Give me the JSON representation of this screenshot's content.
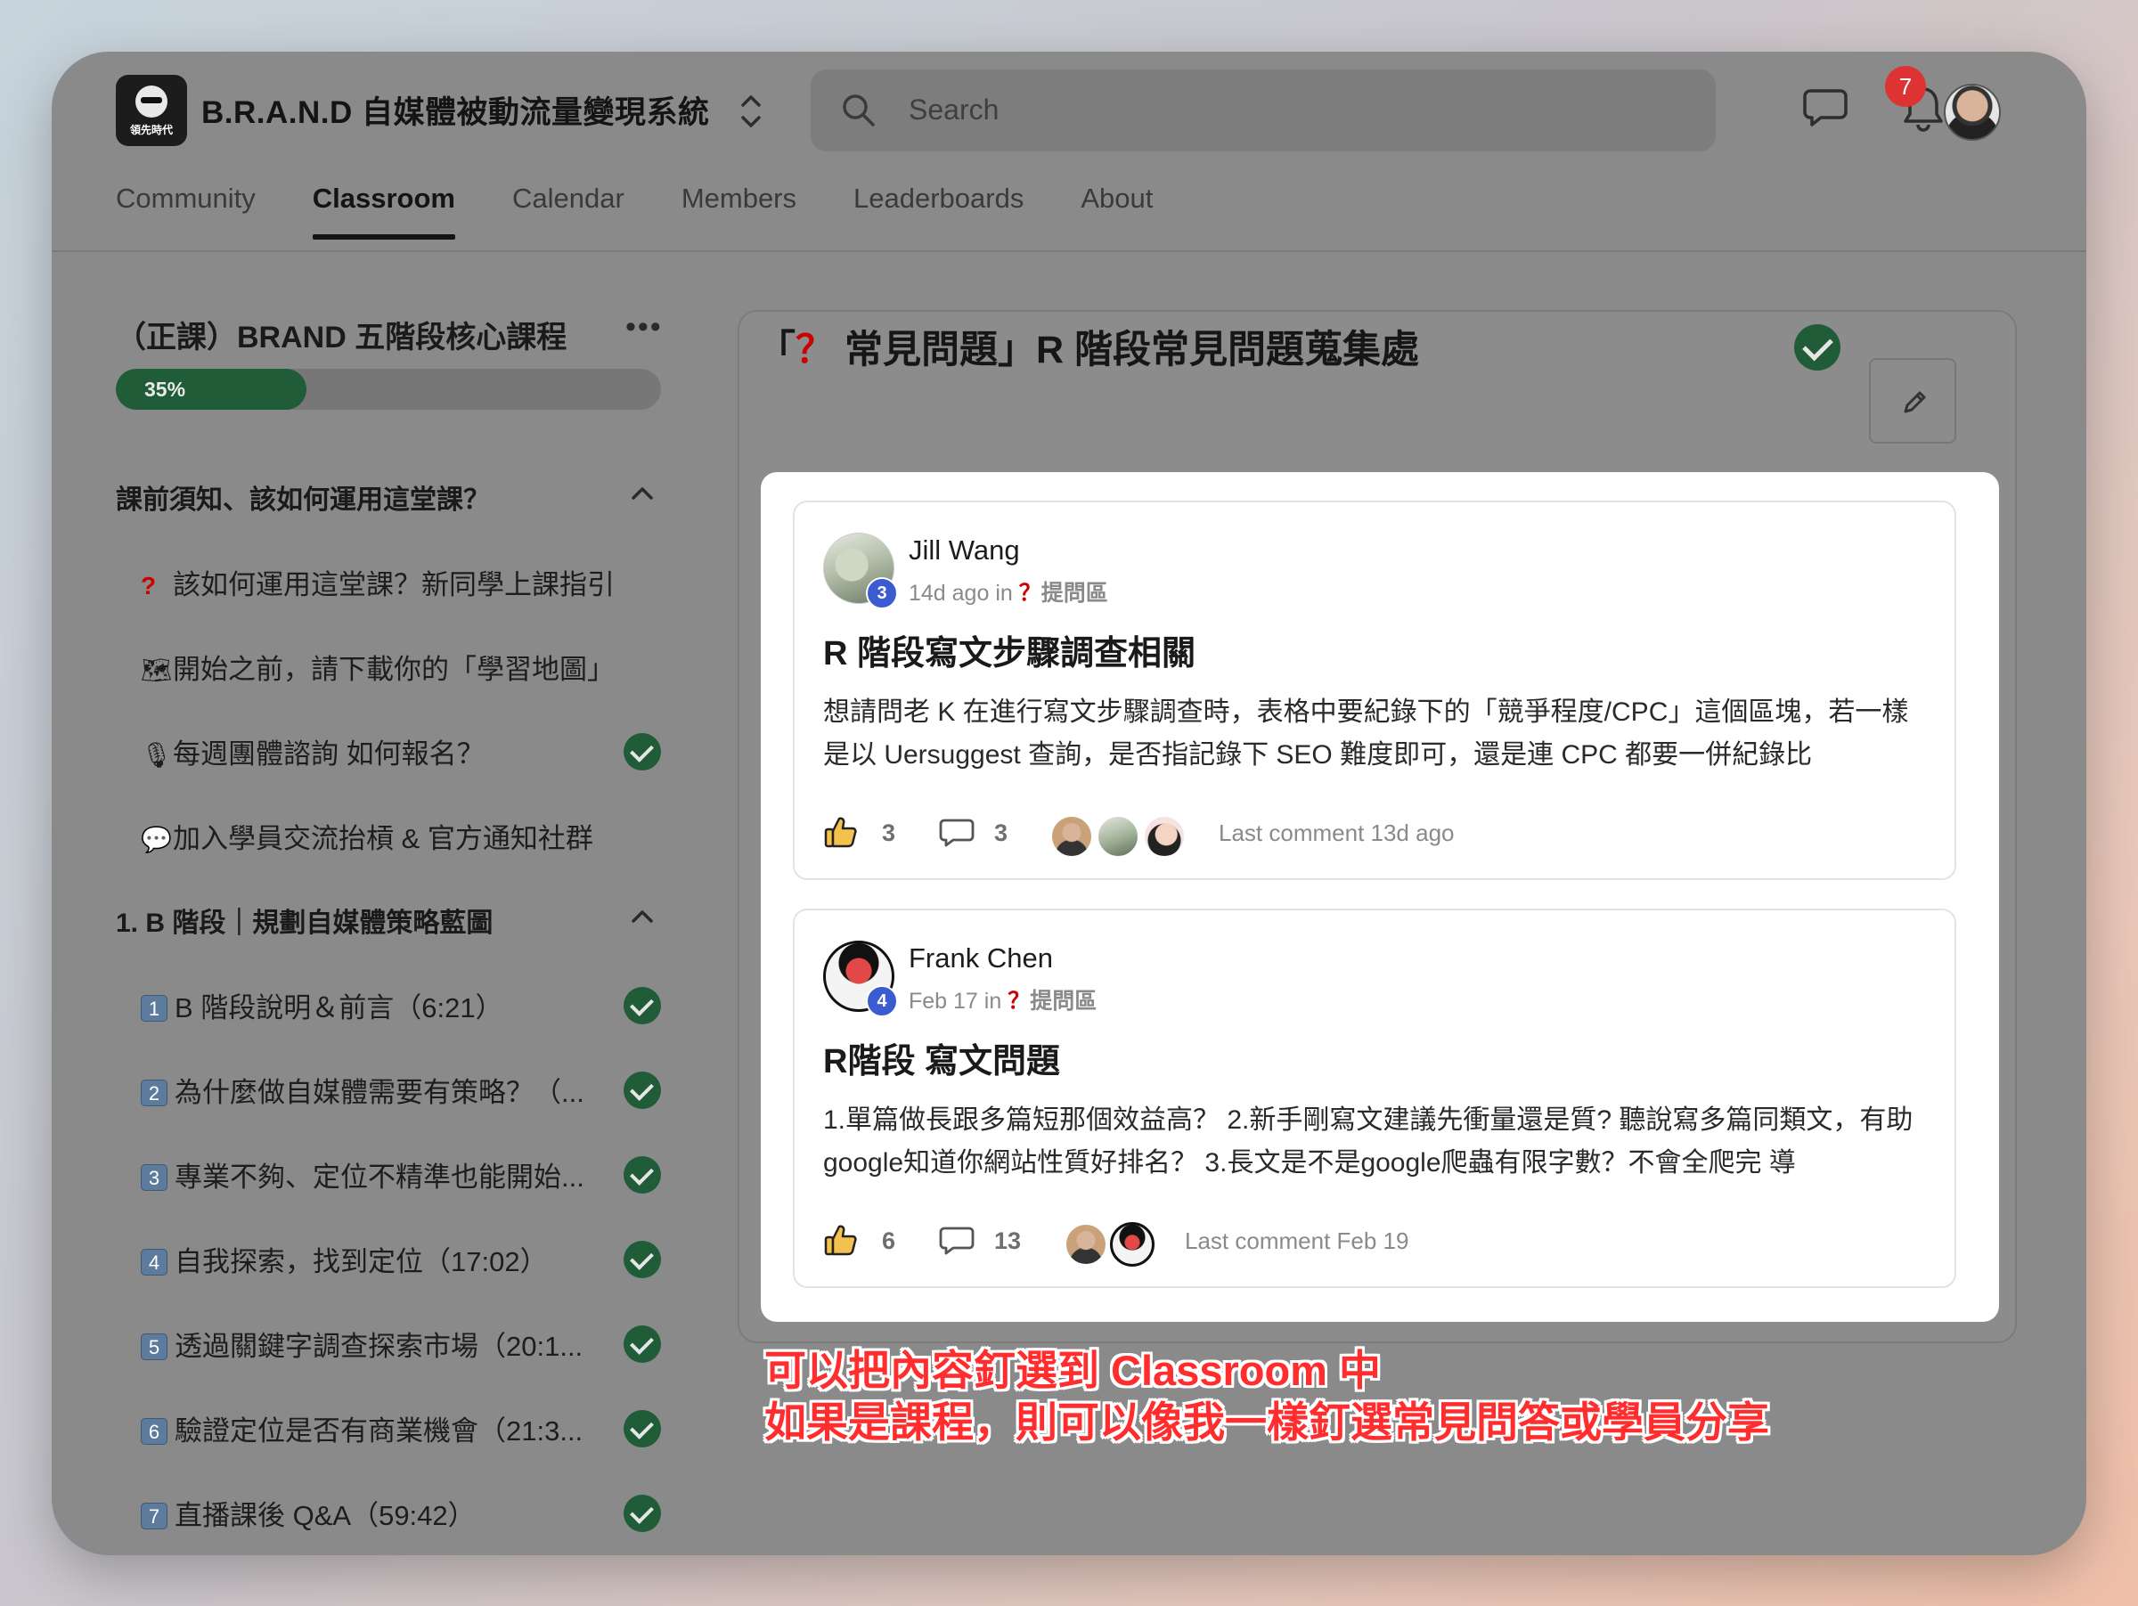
{
  "header": {
    "logo_text": "領先時代",
    "app_name": "B.R.A.N.D 自媒體被動流量變現系統",
    "search_placeholder": "Search",
    "notification_count": "7"
  },
  "tabs": [
    {
      "label": "Community"
    },
    {
      "label": "Classroom"
    },
    {
      "label": "Calendar"
    },
    {
      "label": "Members"
    },
    {
      "label": "Leaderboards"
    },
    {
      "label": "About"
    }
  ],
  "sidebar": {
    "course_title": "（正課）BRAND 五階段核心課程",
    "more_label": "•••",
    "progress_label": "35%",
    "progress_value": 0.35,
    "sections": [
      {
        "title": "課前須知、該如何運用這堂課？",
        "lessons": [
          {
            "glyph": "?",
            "label": "該如何運用這堂課？新同學上課指引",
            "done": false
          },
          {
            "glyph": "🗺",
            "label": "開始之前，請下載你的「學習地圖」",
            "done": false
          },
          {
            "glyph": "🎙",
            "label": "每週團體諮詢 如何報名？",
            "done": true
          },
          {
            "glyph": "💬",
            "label": "加入學員交流抬槓 & 官方通知社群",
            "done": false
          }
        ]
      },
      {
        "title": "1. B 階段｜規劃自媒體策略藍圖",
        "lessons": [
          {
            "num": "1",
            "label": "B 階段說明＆前言（6:21）",
            "done": true
          },
          {
            "num": "2",
            "label": "為什麼做自媒體需要有策略？（...",
            "done": true
          },
          {
            "num": "3",
            "label": "專業不夠、定位不精準也能開始...",
            "done": true
          },
          {
            "num": "4",
            "label": "自我探索，找到定位（17:02）",
            "done": true
          },
          {
            "num": "5",
            "label": "透過關鍵字調查探索市場（20:1...",
            "done": true
          },
          {
            "num": "6",
            "label": "驗證定位是否有商業機會（21:3...",
            "done": true
          },
          {
            "num": "7",
            "label": "直播課後 Q&A（59:42）",
            "done": true
          }
        ]
      }
    ]
  },
  "main": {
    "title_prefix": "「",
    "title_q": "？",
    "title_rest": "常見問題」R 階段常見問題蒐集處"
  },
  "posts": [
    {
      "author": "Jill Wang",
      "level": "3",
      "meta_time": "14d ago in",
      "meta_q": "？",
      "meta_cat": "提問區",
      "title": "R 階段寫文步驟調查相關",
      "body": "想請問老 K 在進行寫文步驟調查時，表格中要紀錄下的「競爭程度/CPC」這個區塊，若一樣是以 Uersuggest 查詢，是否指記錄下 SEO 難度即可，還是連 CPC 都要一併紀錄比",
      "likes": "3",
      "comments": "3",
      "last_comment": "Last comment 13d ago"
    },
    {
      "author": "Frank Chen",
      "level": "4",
      "meta_time": "Feb 17 in",
      "meta_q": "？",
      "meta_cat": "提問區",
      "title": "R階段 寫文問題",
      "body": "1.單篇做長跟多篇短那個效益高？ 2.新手剛寫文建議先衝量還是質? 聽說寫多篇同類文，有助google知道你網站性質好排名？ 3.長文是不是google爬蟲有限字數？不會全爬完 導",
      "likes": "6",
      "comments": "13",
      "last_comment": "Last comment Feb 19"
    }
  ],
  "annotation": {
    "line1": "可以把內容釘選到 Classroom 中",
    "line2": "如果是課程，則可以像我一樣釘選常見問答或學員分享"
  },
  "colors": {
    "overlay_gray": "#8a8a8a",
    "progress_green": "#1f5c37",
    "annotation_red": "#ff2d2d",
    "badge_red": "#dd3333",
    "level_blue": "#3b5bd0"
  }
}
